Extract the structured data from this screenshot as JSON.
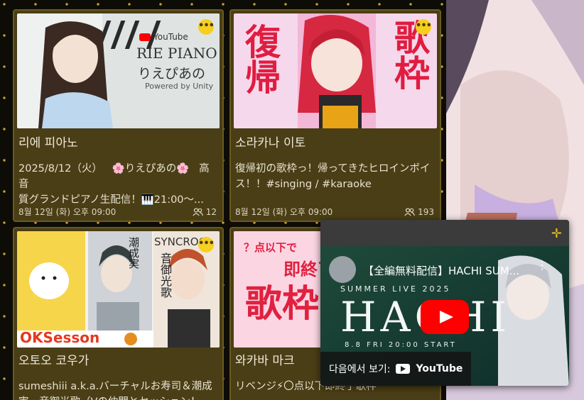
{
  "colors": {
    "card_bg": "#4a3e16",
    "accent_yellow": "#f6cf1f",
    "page_bg": "#0f0d07",
    "youtube_red": "#ff0000"
  },
  "cards": [
    {
      "thumb_brand": "YouTube",
      "thumb_title": "RIE PIANO",
      "thumb_subtitle": "りえぴあの",
      "thumb_powered": "Powered by Unity",
      "title": "리에 피아노",
      "desc_line1": "2025/8/12（火）   🌸りえぴあの🌸   高音",
      "desc_line2": "質グランドピアノ生配信！🎹21:00～...",
      "datetime": "8월 12일 (화) 오후 09:00",
      "viewers": "12"
    },
    {
      "thumb_left": "復帰",
      "thumb_right": "歌枠",
      "title": "소라카나 이토",
      "desc_line1": "復帰初の歌枠っ！帰ってきたヒロインボイ",
      "desc_line2": "ス！！#singing / #karaoke",
      "datetime": "8월 12일 (화) 오후 09:00",
      "viewers": "193"
    },
    {
      "thumb_brand": "SYNCROO",
      "thumb_names": "潮成実",
      "thumb_names2": "音御光歌",
      "thumb_bottom": "OKSesson",
      "title": "오토오 코우가",
      "desc_line1": "sumeshiii a.k.a.バーチャルお寿司＆潮成",
      "desc_line2": "実・音御光歌（Vの仲間とセッション！"
    },
    {
      "thumb_top": "？点以下で",
      "thumb_top2": "即終了",
      "thumb_main": "歌枠",
      "title": "와카바 마크",
      "desc_line1": "リベンジ⚡〇点以下即終了歌枠"
    }
  ],
  "player": {
    "video_title": "【全編無料配信】HACHI SUM...",
    "banner_top": "SUMMER LIVE 2025",
    "banner_main": "HACHI",
    "banner_date": "8.8 FRI 20:00 START",
    "watch_on": "다음에서 보기:",
    "watch_on_brand": "YouTube"
  }
}
